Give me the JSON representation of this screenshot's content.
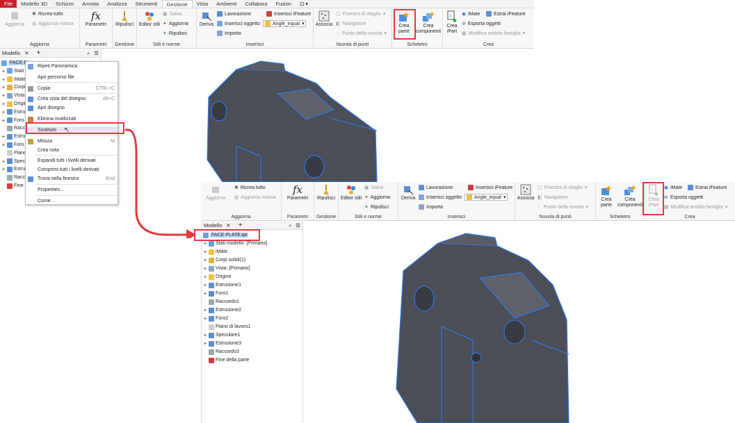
{
  "top": {
    "menu_tabs": [
      "File",
      "Modello 3D",
      "Schizzo",
      "Annota",
      "Analizza",
      "Strumenti",
      "Gestione",
      "Vista",
      "Ambienti",
      "Collabora",
      "Fusion"
    ],
    "active_tab": "Gestione",
    "groups": {
      "aggiorna": {
        "label": "Aggiorna",
        "big": "Aggiorna",
        "ricrea": "Ricrea tutto",
        "aggiorna_massa": "Aggiorna massa"
      },
      "parametri": {
        "label": "Parametri",
        "big": "Parametri"
      },
      "gestione": {
        "label": "Gestione",
        "big": "Ripulisci"
      },
      "stili": {
        "label": "Stili e norme",
        "big": "Editor stili",
        "salva": "Salva",
        "aggiorna": "Aggiorna",
        "ripulisci": "Ripulisci"
      },
      "inserisci": {
        "label": "Inserisci",
        "deriva": "Deriva",
        "lavorazione": "Lavorazione",
        "inserisci_oggetto": "Inserisci oggetto",
        "importa": "Importa",
        "ifeature": "Inserisci iFeature",
        "dropdown": "Angle_equal"
      },
      "nuvola": {
        "label": "Nuvola di punti",
        "associa": "Associa",
        "finestra": "Finestra di ritaglio",
        "navigatore": "Navigatore",
        "punto": "Punto della nuvola"
      },
      "scheletro": {
        "label": "Scheletro",
        "crea_parte": "Crea parte",
        "crea_componenti": "Crea componenti"
      },
      "crea": {
        "label": "Crea",
        "crea_ipart": "Crea iPart",
        "imate": "iMate",
        "estrai": "Estrai iFeature",
        "esporta": "Esporta oggetti",
        "modifica": "Modifica ambito famiglia"
      }
    },
    "panel": {
      "tab": "Modello",
      "selected_item": "FACE P"
    },
    "tree_items": [
      "Stati",
      "iMate",
      "Corpi",
      "Vista",
      "Origine",
      "Estrusione",
      "Foro",
      "Raccordo",
      "Estrusione",
      "Foro",
      "Piano",
      "Speculare",
      "Estrusione",
      "Raccordo",
      "Fine"
    ],
    "context_menu": [
      {
        "label": "Ripeti Panoramica",
        "shortcut": ""
      },
      {
        "label": "Apri percorso file",
        "shortcut": ""
      },
      {
        "label": "Copia",
        "shortcut": "CTRL+C"
      },
      {
        "label": "Crea vista del disegno",
        "shortcut": "Alt+C"
      },
      {
        "label": "Apri disegno",
        "shortcut": ""
      },
      {
        "label": "Elimina inutilizzati",
        "shortcut": ""
      },
      {
        "label": "Sostituto",
        "shortcut": ""
      },
      {
        "label": "Misura",
        "shortcut": "M"
      },
      {
        "label": "Crea nota",
        "shortcut": ""
      },
      {
        "label": "Espandi tutti i livelli derivati",
        "shortcut": ""
      },
      {
        "label": "Comprimi tutti i livelli derivati",
        "shortcut": ""
      },
      {
        "label": "Trova nella finestra",
        "shortcut": "End"
      },
      {
        "label": "Properties...",
        "shortcut": ""
      },
      {
        "label": "Come...",
        "shortcut": ""
      }
    ]
  },
  "bottom": {
    "groups": {
      "aggiorna": {
        "label": "Aggiorna",
        "big": "Aggiorna",
        "ricrea": "Ricrea tutto",
        "aggiorna_massa": "Aggiorna massa"
      },
      "parametri": {
        "label": "Parametri",
        "big": "Parametri"
      },
      "gestione": {
        "label": "Gestione",
        "big": "Ripulisci"
      },
      "stili": {
        "label": "Stili e norme",
        "big": "Editor stili",
        "salva": "Salva",
        "aggiorna": "Aggiorna",
        "ripulisci": "Ripulisci"
      },
      "inserisci": {
        "label": "Inserisci",
        "deriva": "Deriva",
        "lavorazione": "Lavorazione",
        "inserisci_oggetto": "Inserisci oggetto",
        "importa": "Importa",
        "ifeature": "Inserisci iFeature",
        "dropdown": "Angle_equal"
      },
      "nuvola": {
        "label": "Nuvola di punti",
        "associa": "Associa",
        "finestra": "Finestra di ritaglio",
        "navigatore": "Navigatore",
        "punto": "Punto della nuvola"
      },
      "scheletro": {
        "label": "Scheletro",
        "crea_parte": "Crea parte",
        "crea_componenti": "Crea componenti"
      },
      "crea": {
        "label": "Crea",
        "crea_ipart": "Crea iPart",
        "imate": "iMate",
        "estrai": "Estrai iFeature",
        "esporta": "Esporta oggetti",
        "modifica": "Modifica ambito famiglia"
      }
    },
    "panel": {
      "tab": "Modello",
      "selected_item": "FACE PLATE.ipt"
    },
    "tree_items": [
      "Stati modello: [Primario]",
      "iMate",
      "Corpi solidi(1)",
      "Vista: [Primario]",
      "Origine",
      "Estrusione1",
      "Foro1",
      "Raccordo1",
      "Estrusione2",
      "Foro2",
      "Piano di lavoro1",
      "Speculare1",
      "Estrusione3",
      "Raccordo3",
      "Fine della parte"
    ]
  },
  "colors": {
    "highlight": "#e0393e",
    "accent": "#1f6fd1",
    "selection": "#b9d7f5",
    "solid": "#4b4d57"
  }
}
